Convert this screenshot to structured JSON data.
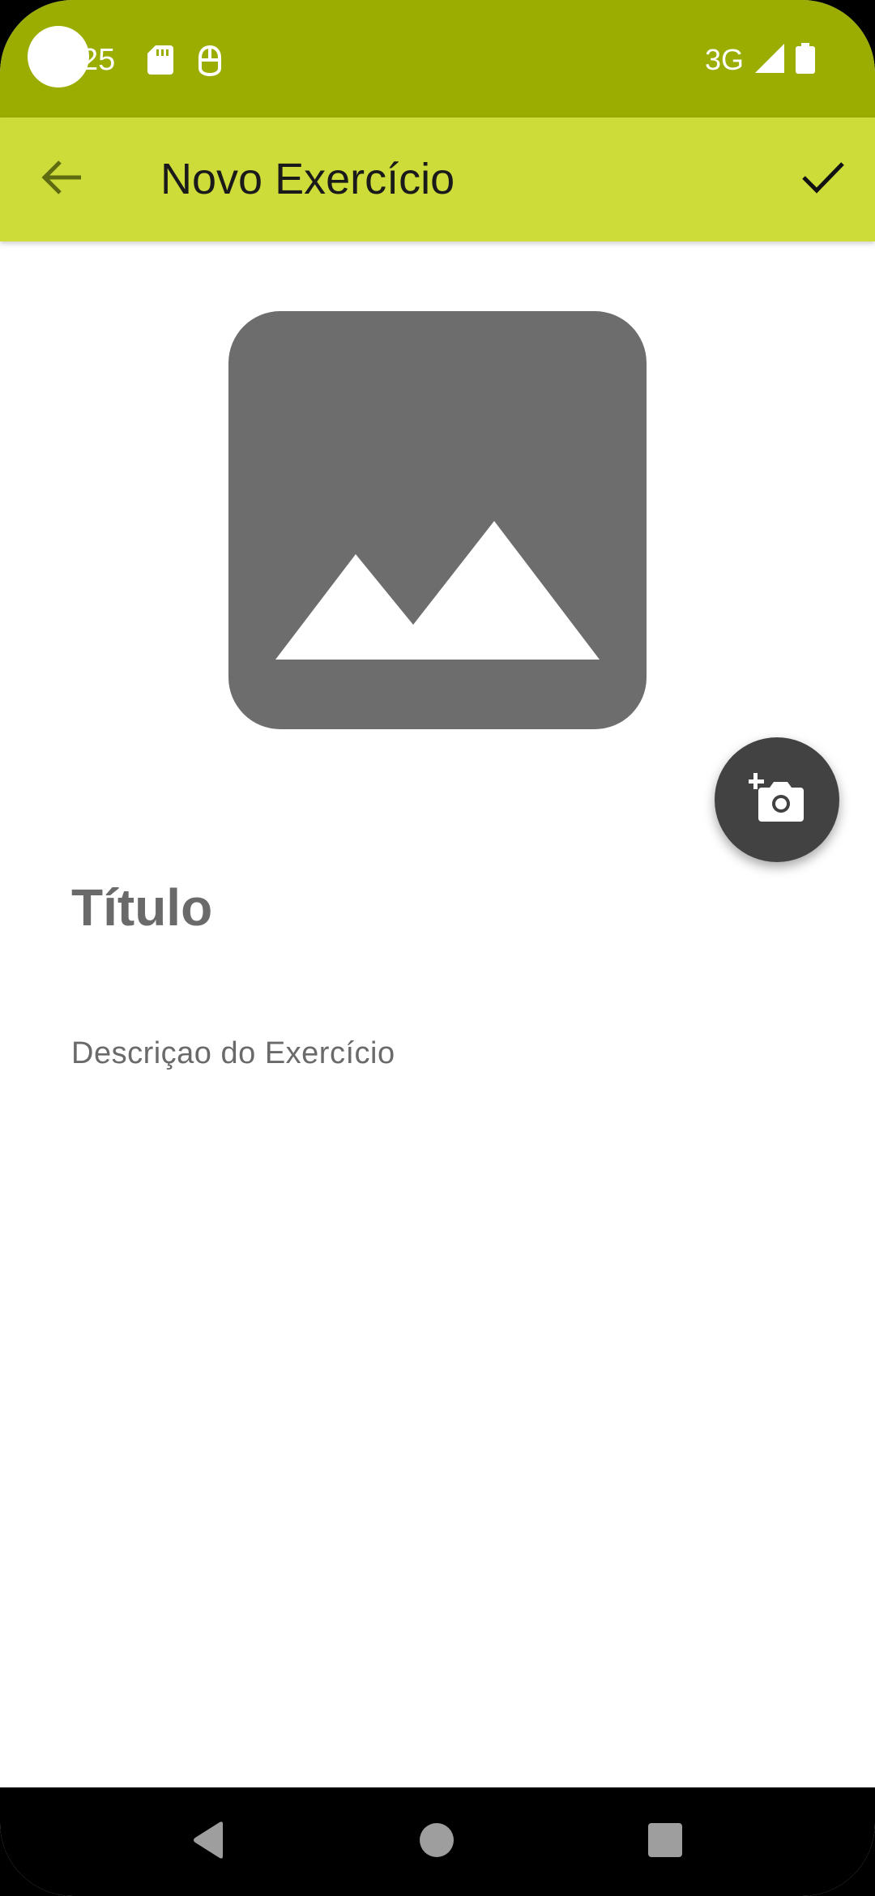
{
  "status_bar": {
    "time": "25",
    "network": "3G",
    "icons": [
      "sd-card-icon",
      "assistant-icon",
      "signal-icon",
      "battery-icon"
    ]
  },
  "app_bar": {
    "title": "Novo Exercício",
    "back_icon": "arrow-back-icon",
    "save_icon": "check-icon"
  },
  "form": {
    "image_icon": "image-placeholder-icon",
    "camera_icon": "add-a-photo-icon",
    "title_placeholder": "Título",
    "description_placeholder": "Descriçao do Exercício"
  },
  "nav_bar": {
    "icons": [
      "nav-back-icon",
      "nav-home-icon",
      "nav-recents-icon"
    ]
  },
  "colors": {
    "status_bar": "#9aad00",
    "app_bar": "#cddc39",
    "placeholder_bg": "#6d6d6d",
    "fab": "#424242",
    "hint_text": "#6a6a6a"
  }
}
